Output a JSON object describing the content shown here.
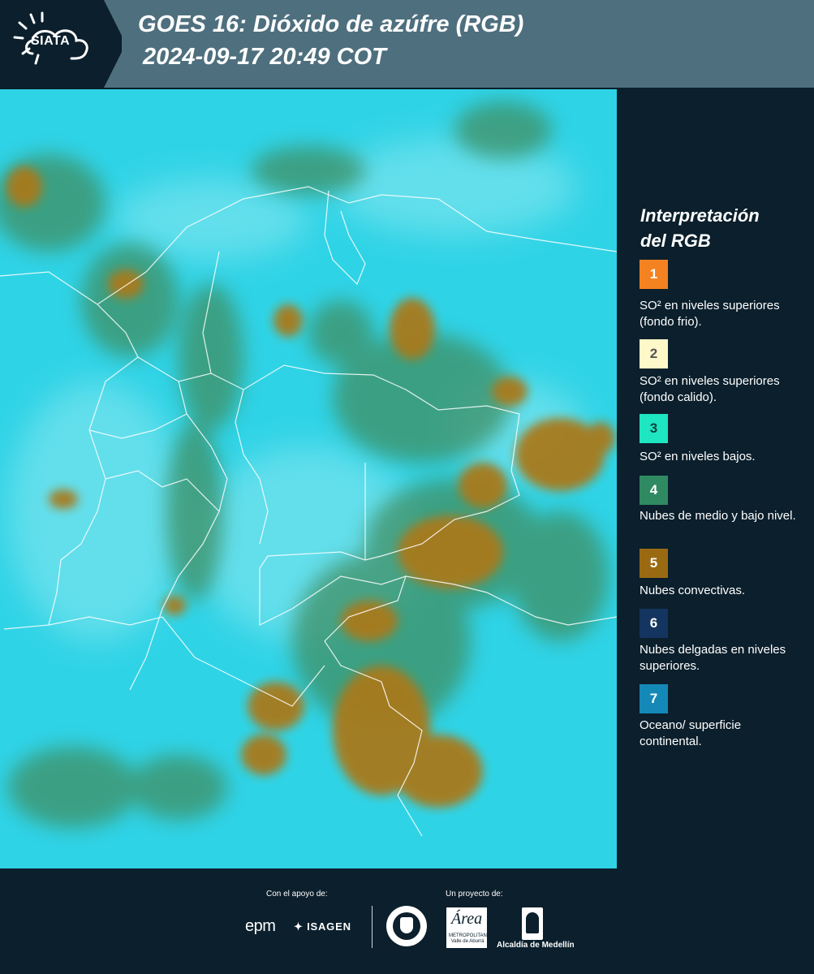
{
  "header": {
    "logo_text": "SIATA",
    "title_line1": "GOES 16: Dióxido de azúfre (RGB)",
    "title_line2": "2024-09-17 20:49 COT"
  },
  "map": {
    "background_color": "#2fd3e6",
    "cloud_color": "#a87a1e",
    "mid_cloud_color": "#3f8f63",
    "border_color": "#ffffff"
  },
  "legend": {
    "title_line1": "Interpretación",
    "title_line2": "del RGB",
    "items": [
      {
        "number": "1",
        "color": "#f58220",
        "text_color": "#ffffff",
        "label": "SO² en niveles superiores (fondo frio)."
      },
      {
        "number": "2",
        "color": "#fff8c8",
        "text_color": "#555555",
        "label": "SO² en niveles superiores (fondo calido)."
      },
      {
        "number": "3",
        "color": "#1ee6c0",
        "text_color": "#0b4040",
        "label": "SO² en niveles bajos."
      },
      {
        "number": "4",
        "color": "#2f8a62",
        "text_color": "#ffffff",
        "label": "Nubes de medio y bajo nivel."
      },
      {
        "number": "5",
        "color": "#9a6a12",
        "text_color": "#ffffff",
        "label": "Nubes convectivas."
      },
      {
        "number": "6",
        "color": "#143560",
        "text_color": "#ffffff",
        "label": "Nubes delgadas en niveles superiores."
      },
      {
        "number": "7",
        "color": "#1489b8",
        "text_color": "#ffffff",
        "label": "Oceano/ superficie continental."
      }
    ]
  },
  "footer": {
    "support_label": "Con el apoyo de:",
    "project_label": "Un proyecto de:",
    "epm_logo_text": "epm",
    "isagen_logo_text": "ISAGEN",
    "area_logo_text": "Área",
    "area_logo_sub": "METROPOLITANA Valle de Aburrá",
    "alcaldia_label": "Alcaldía de Medellín"
  }
}
